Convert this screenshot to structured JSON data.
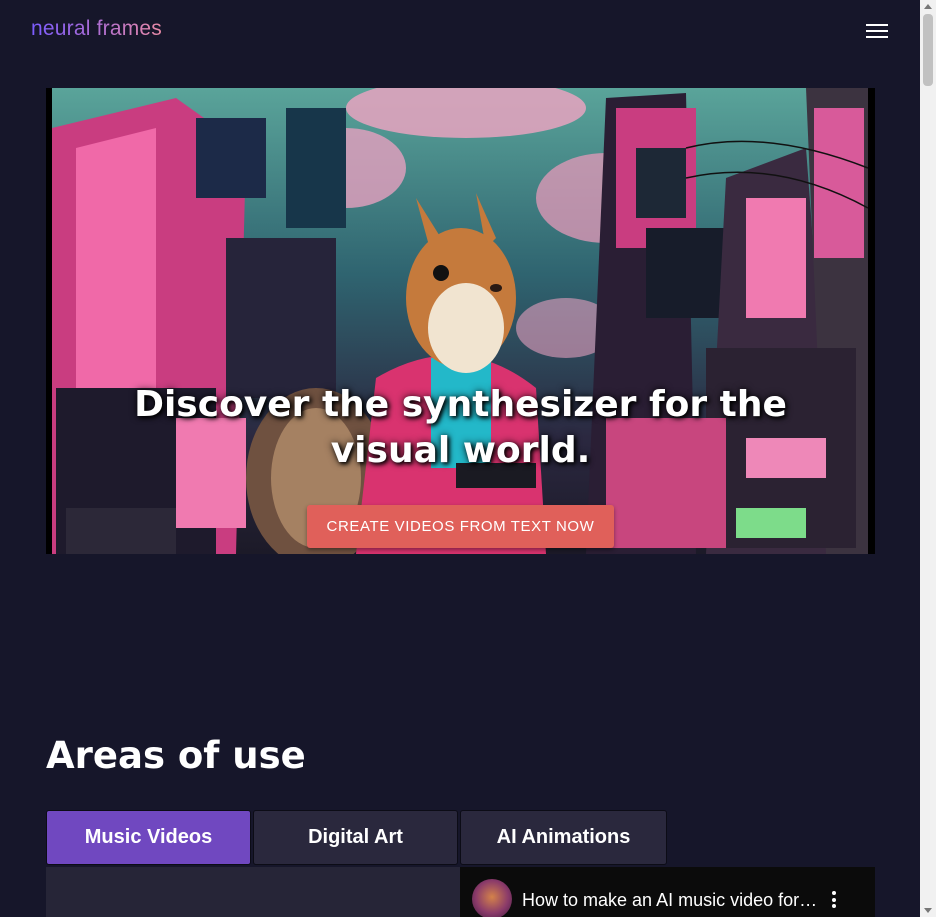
{
  "header": {
    "logo_text": "neural frames",
    "menu_icon": "hamburger-menu-icon"
  },
  "hero": {
    "title": "Discover the synthesizer for the visual world.",
    "cta_label": "CREATE VIDEOS FROM TEXT NOW",
    "image_subject": "squirrel in neon city"
  },
  "areas": {
    "title": "Areas of use",
    "tabs": [
      {
        "label": "Music Videos",
        "active": true
      },
      {
        "label": "Digital Art",
        "active": false
      },
      {
        "label": "AI Animations",
        "active": false
      }
    ]
  },
  "video": {
    "title": "How to make an AI music video for…",
    "more_icon": "more-vert-icon"
  },
  "colors": {
    "background": "#16162a",
    "cta": "#e0605a",
    "active_tab": "#7048c0",
    "inactive_tab": "#2a283d"
  }
}
